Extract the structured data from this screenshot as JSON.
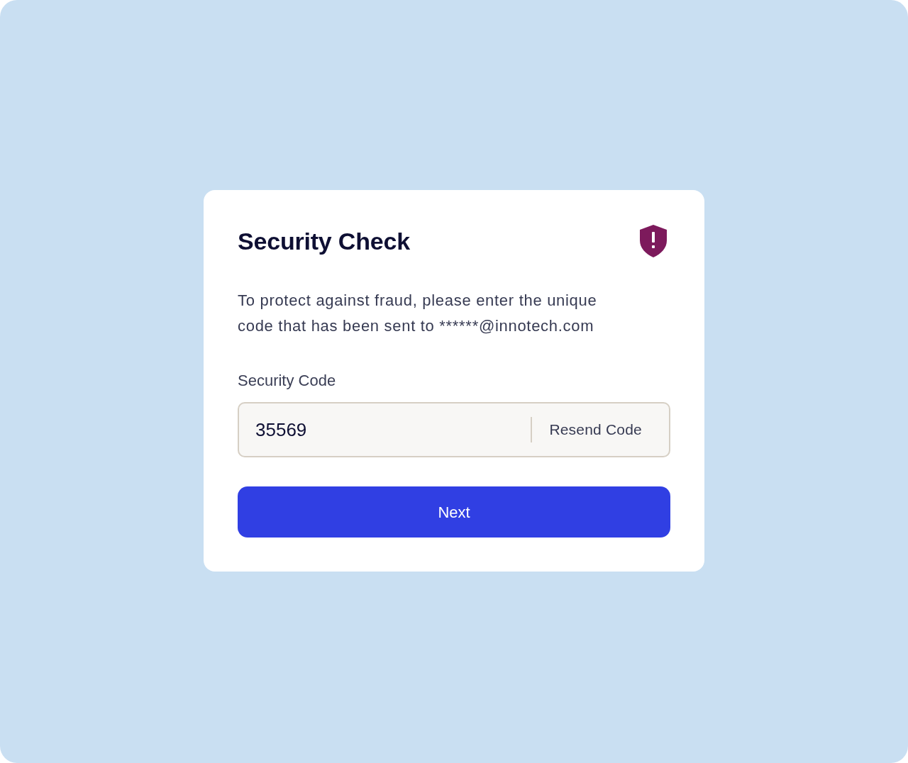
{
  "dialog": {
    "title": "Security Check",
    "message": "To protect against fraud, please enter the unique code that has been sent to ******@innotech.com"
  },
  "field": {
    "label": "Security Code",
    "value": "35569",
    "action": "Resend Code"
  },
  "buttons": [
    "Next"
  ]
}
